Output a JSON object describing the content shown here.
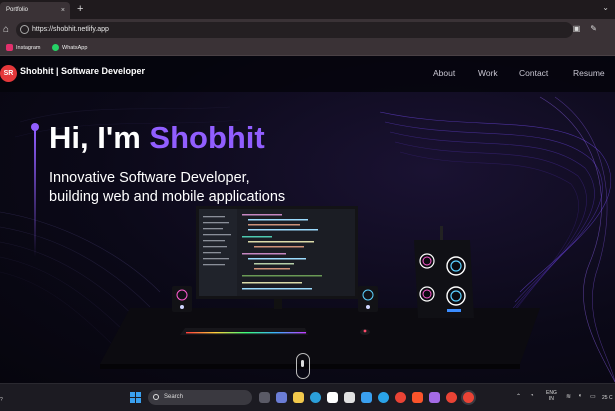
{
  "browser": {
    "tab_title": "Portfolio",
    "tab_close": "×",
    "new_tab": "+",
    "window_controls": "⌄",
    "home_icon": "⌂",
    "url": "https://shobhit.netlify.app",
    "bookmarks": [
      {
        "label": "Instagram",
        "icon": "instagram-icon",
        "color": "#e1306c"
      },
      {
        "label": "WhatsApp",
        "icon": "whatsapp-icon",
        "color": "#25d366"
      }
    ]
  },
  "site": {
    "logo_text": "SR",
    "brand": "Shobhit | Software Developer",
    "nav": [
      "About",
      "Work",
      "Contact",
      "Resume"
    ],
    "hero_greeting": "Hi, I'm ",
    "hero_name": "Shobhit",
    "hero_sub_line1": "Innovative Software Developer,",
    "hero_sub_line2": "building web and mobile applications",
    "accent_color": "#915eff"
  },
  "taskbar": {
    "left_fragment": "?",
    "search_placeholder": "Search",
    "lang_line1": "ENG",
    "lang_line2": "IN",
    "clock_fragment": "25 C"
  }
}
